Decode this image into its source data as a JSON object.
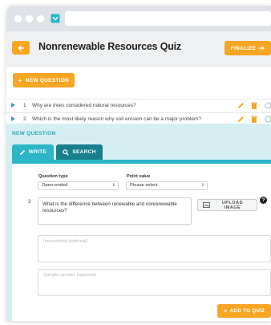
{
  "colors": {
    "accent": "#f6a623",
    "teal": "#2bb5c6",
    "teal_dark": "#1a7f8d",
    "panel_bg": "#d5eef2"
  },
  "header": {
    "back_icon": "arrow-left-icon",
    "title": "Nonrenewable Resources Quiz",
    "finalize_label": "FINALIZE"
  },
  "toolbar": {
    "new_question_label": "NEW QUESTION"
  },
  "questions": [
    {
      "number": "1",
      "text": "Why are trees considered natural resources?"
    },
    {
      "number": "2",
      "text": "Which is the most likely reason why soil erosion can be a major problem?"
    }
  ],
  "editor": {
    "section_label": "NEW QUESTION",
    "tabs": [
      {
        "label": "WRITE",
        "icon": "pencil-icon"
      },
      {
        "label": "SEARCH",
        "icon": "search-icon"
      }
    ],
    "question_type": {
      "label": "Question type",
      "value": "Open-ended"
    },
    "point_value": {
      "label": "Point value",
      "value": "Please select"
    },
    "question_number": "3",
    "question_text": "What is the difference between renewable and nonrenewable resources?",
    "upload_label": "UPLOAD IMAGE",
    "help_label": "?",
    "instructions_placeholder": "Instructions (optional)",
    "sample_answer_placeholder": "Sample answer (optional)",
    "add_label": "ADD TO QUIZ"
  }
}
